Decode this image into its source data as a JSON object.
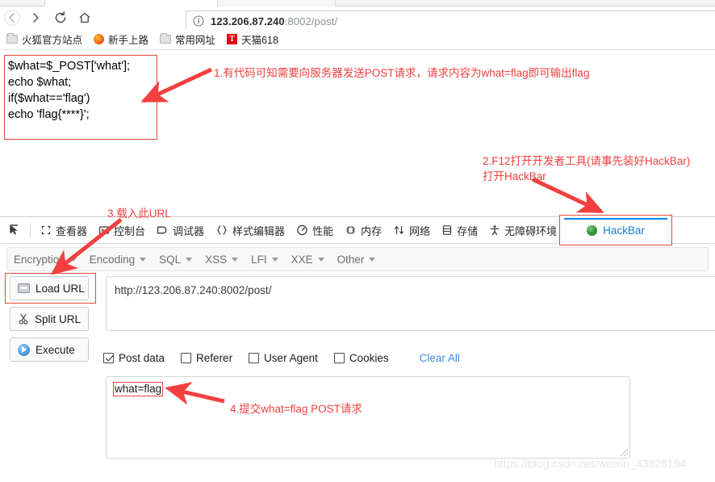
{
  "browser": {
    "nav": {
      "back": "back-arrow",
      "forward": "forward-arrow",
      "reload": "reload",
      "home": "home"
    },
    "url_display": {
      "scheme_info": "info-icon",
      "host": "123.206.87.240",
      "port": ":8002",
      "path": "/post/"
    },
    "bookmarks": [
      {
        "label": "火狐官方站点",
        "icon": "folder-icon"
      },
      {
        "label": "新手上路",
        "icon": "firefox-icon"
      },
      {
        "label": "常用网址",
        "icon": "folder-icon"
      },
      {
        "label": "天猫618",
        "icon": "tmall-icon"
      }
    ]
  },
  "page": {
    "code_lines": [
      "$what=$_POST['what'];",
      "echo $what;",
      "if($what=='flag')",
      "echo 'flag{****}';"
    ]
  },
  "devtools": {
    "picker_icon": "element-picker-icon",
    "tabs": [
      {
        "label": "查看器",
        "icon": "inspector-icon"
      },
      {
        "label": "控制台",
        "icon": "console-icon"
      },
      {
        "label": "调试器",
        "icon": "debugger-icon"
      },
      {
        "label": "样式编辑器",
        "icon": "style-editor-icon"
      },
      {
        "label": "性能",
        "icon": "performance-icon"
      },
      {
        "label": "内存",
        "icon": "memory-icon"
      },
      {
        "label": "网络",
        "icon": "network-icon"
      },
      {
        "label": "存储",
        "icon": "storage-icon"
      },
      {
        "label": "无障碍环境",
        "icon": "accessibility-icon"
      }
    ],
    "hackbar_tab": {
      "label": "HackBar",
      "icon": "hackbar-globe-icon",
      "active": true
    }
  },
  "hackbar": {
    "menus": [
      {
        "label": "Encryption"
      },
      {
        "label": "Encoding"
      },
      {
        "label": "SQL"
      },
      {
        "label": "XSS"
      },
      {
        "label": "LFI"
      },
      {
        "label": "XXE"
      },
      {
        "label": "Other"
      }
    ],
    "buttons": [
      {
        "label": "Load URL",
        "icon": "load-url-icon"
      },
      {
        "label": "Split URL",
        "icon": "split-url-icon"
      },
      {
        "label": "Execute",
        "icon": "execute-icon"
      }
    ],
    "url_value": "http://123.206.87.240:8002/post/",
    "options": [
      {
        "label": "Post data",
        "checked": true
      },
      {
        "label": "Referer",
        "checked": false
      },
      {
        "label": "User Agent",
        "checked": false
      },
      {
        "label": "Cookies",
        "checked": false
      }
    ],
    "clear_all_label": "Clear All",
    "post_data_value": "what=flag"
  },
  "annotations": {
    "step1": "1.有代码可知需要向服务器发送POST请求，请求内容为what=flag即可输出flag",
    "step2_line1": "2.F12打开开发者工具(请事先装好HackBar)",
    "step2_line2": "打开HackBar",
    "step3": "3.载入此URL",
    "step4": "4.提交what=flag POST请求"
  },
  "watermark": "https://blog.csdn.net/weixin_43826194",
  "colors": {
    "annotation_red": "#f24040",
    "highlight_box": "#e8453c",
    "link_blue": "#3e8ede",
    "active_tab_blue": "#0a84ff"
  }
}
